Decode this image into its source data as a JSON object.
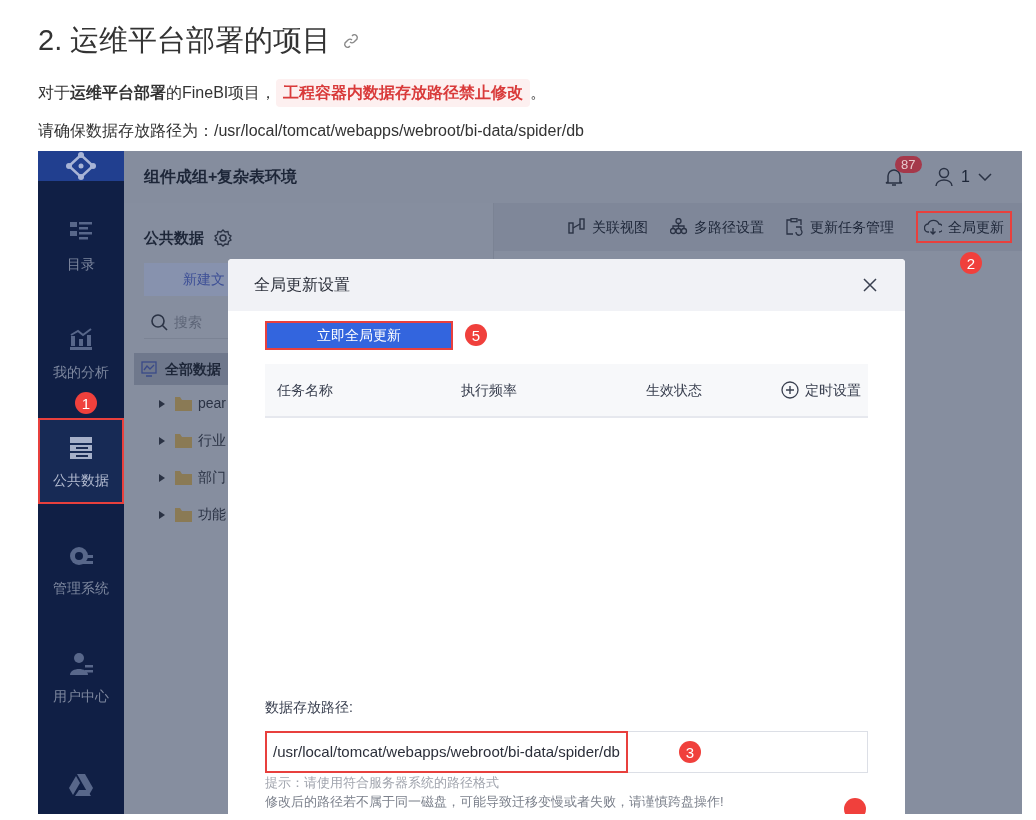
{
  "heading": {
    "text": "2. 运维平台部署的项目"
  },
  "paragraphs": [
    {
      "segments": [
        {
          "kind": "text",
          "text": "对于**运维平台部署**的FineBI项目，"
        },
        {
          "kind": "highlight",
          "text": "工程容器内数据存放路径禁止修改"
        },
        {
          "kind": "text",
          "text": "。"
        }
      ]
    },
    {
      "segments": [
        {
          "kind": "text",
          "text": "请确保数据存放路径为：/usr/local/tomcat/webapps/webroot/bi-data/spider/db"
        }
      ]
    }
  ],
  "app": {
    "title": "组件成组+复杂表环境",
    "notification_count": "87",
    "user": "1",
    "sidebar": {
      "items": [
        {
          "kind": "list",
          "label": "目录",
          "selected": false
        },
        {
          "kind": "chart",
          "label": "我的分析",
          "selected": false
        },
        {
          "kind": "stack",
          "label": "公共数据",
          "selected": true,
          "annotation": "1"
        },
        {
          "kind": "gear",
          "label": "管理系统",
          "selected": false
        },
        {
          "kind": "user",
          "label": "用户中心",
          "selected": false
        },
        {
          "kind": "drive",
          "selected": false
        }
      ]
    },
    "panel": {
      "title": "公共数据",
      "new_button": "新建文",
      "search": {
        "placeholder": "搜索"
      },
      "tree": [
        {
          "label": "全部数据",
          "selected": true,
          "children": [
            {
              "label": "pear",
              "selected": false
            },
            {
              "label": "行业",
              "selected": false
            },
            {
              "label": "部门",
              "selected": false
            },
            {
              "label": "功能",
              "selected": false
            }
          ]
        }
      ]
    },
    "toolbar": [
      {
        "kind": "view",
        "label": "关联视图"
      },
      {
        "kind": "paths",
        "label": "多路径设置"
      },
      {
        "kind": "tasks",
        "label": "更新任务管理"
      },
      {
        "kind": "cloud",
        "label": "全局更新",
        "annotation": "2"
      }
    ],
    "dialog": {
      "title": "全局更新设置",
      "primary_button": {
        "label": "立即全局更新",
        "annotation": "5"
      },
      "table": {
        "columns": [
          "任务名称",
          "执行频率",
          "生效状态"
        ],
        "action": "定时设置"
      },
      "path": {
        "label": "数据存放路径:",
        "value": "/usr/local/tomcat/webapps/webroot/bi-data/spider/db",
        "annotation": "3"
      },
      "hints": [
        "提示：请使用符合服务器系统的路径格式",
        "修改后的路径若不属于同一磁盘，可能导致迁移变慢或者失败，请谨慎跨盘操作!"
      ],
      "cut_marker": true
    }
  }
}
